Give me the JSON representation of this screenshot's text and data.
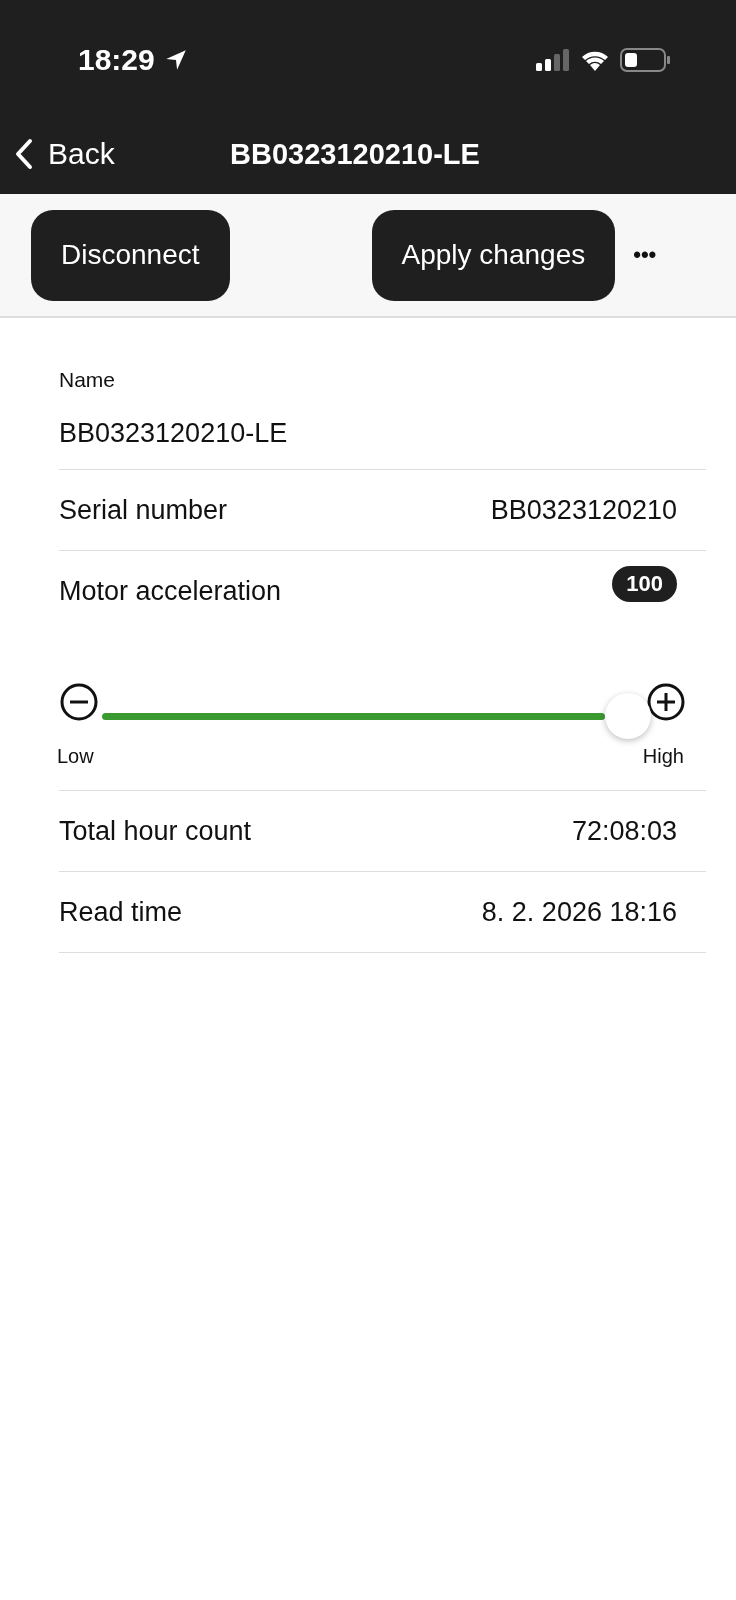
{
  "status_bar": {
    "time": "18:29"
  },
  "nav_bar": {
    "back": "Back",
    "title": "BB0323120210-LE"
  },
  "toolbar": {
    "buttons": [
      "Disconnect",
      "Apply changes"
    ],
    "more": "•••"
  },
  "name_field": {
    "label": "Name",
    "value": "BB0323120210-LE"
  },
  "rows_top": [
    {
      "label": "Serial number",
      "value": "BB0323120210"
    }
  ],
  "motor_acceleration": {
    "label": "Motor acceleration",
    "badge": "100",
    "level": 1.0,
    "low": "Low",
    "high": "High"
  },
  "rows_bottom": [
    {
      "label": "Total hour count",
      "value": "72:08:03"
    },
    {
      "label": "Read time",
      "value": "8. 2. 2026 18:16"
    }
  ]
}
